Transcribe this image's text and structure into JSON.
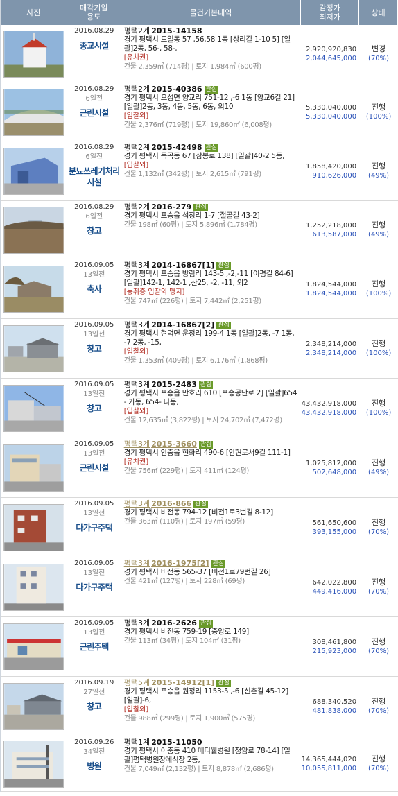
{
  "header": {
    "photo": "사진",
    "date_use": "매각기일\n용도",
    "info": "물건기본내역",
    "price": "감정가\n최저가",
    "status": "상태"
  },
  "listings": [
    {
      "date": "2016.08.29",
      "ago": "",
      "use": "종교시설",
      "court": "평택2계",
      "case": "2015-14158",
      "interest": "",
      "addr": "경기 평택시 도일동 57 ,56,58 1동 [상리길 1-10 5] [일괄]2동, 56-, 58-,",
      "tags": "[유치권]",
      "size": "건물 2,359㎡ (714평) | 토지 1,984㎡ (600평)",
      "appraisal": "2,920,920,830",
      "minprice": "2,044,645,000",
      "status": "변경",
      "rate": "(70%)",
      "visited": false,
      "photo": "church"
    },
    {
      "date": "2016.08.29",
      "ago": "6일전",
      "use": "근린시설",
      "court": "평택2계",
      "case": "2015-40386",
      "interest": "관심",
      "addr": "경기 평택시 오성면 양교리 751-12 ,-6 1동 [양교6길 21] [일괄]2동, 3동, 4동, 5동, 6동, 외10",
      "tags": "[입찰외]",
      "size": "건물 2,376㎡ (719평) | 토지 19,860㎡ (6,008평)",
      "appraisal": "5,330,040,000",
      "minprice": "5,330,040,000",
      "status": "진행",
      "rate": "(100%)",
      "visited": false,
      "photo": "greenhouse"
    },
    {
      "date": "2016.08.29",
      "ago": "6일전",
      "use": "분뇨쓰레기처리시설",
      "court": "평택2계",
      "case": "2015-42498",
      "interest": "관심",
      "addr": "경기 평택시 독곡동 67 [삼봉로 138] [일괄]40-2 5동,",
      "tags": "[입찰외]",
      "size": "건물 1,132㎡ (342평) | 토지 2,615㎡ (791평)",
      "appraisal": "1,858,420,000",
      "minprice": "910,626,000",
      "status": "진행",
      "rate": "(49%)",
      "visited": false,
      "photo": "warehouse"
    },
    {
      "date": "2016.08.29",
      "ago": "6일전",
      "use": "창고",
      "court": "평택2계",
      "case": "2016-279",
      "interest": "관심",
      "addr": "경기 평택시 포승읍 석정리 1-7 [절골길 43-2]",
      "tags": "",
      "size": "건물 198㎡ (60평) | 토지 5,896㎡ (1,784평)",
      "appraisal": "1,252,218,000",
      "minprice": "613,587,000",
      "status": "진행",
      "rate": "(49%)",
      "visited": false,
      "photo": "field"
    },
    {
      "date": "2016.09.05",
      "ago": "13일전",
      "use": "축사",
      "court": "평택3계",
      "case": "2014-16867[1]",
      "interest": "관심",
      "addr": "경기 평택시 포승읍 방림리 143-5 ,-2,-11 [이평길 84-6] [일괄]142-1, 142-1 ,산25, -2, -11, 외2",
      "tags": "[농취증  입찰외  맹지]",
      "size": "건물 747㎡ (226평) | 토지 7,442㎡ (2,251평)",
      "appraisal": "1,824,544,000",
      "minprice": "1,824,544,000",
      "status": "진행",
      "rate": "(100%)",
      "visited": false,
      "photo": "barn"
    },
    {
      "date": "2016.09.05",
      "ago": "13일전",
      "use": "창고",
      "court": "평택3계",
      "case": "2014-16867[2]",
      "interest": "관심",
      "addr": "경기 평택시 현덕면 운정리 199-4 1동 [일괄]2동, -7 1동, -7 2동, -15,",
      "tags": "[입찰외]",
      "size": "건물 1,353㎡ (409평) | 토지 6,176㎡ (1,868평)",
      "appraisal": "2,348,214,000",
      "minprice": "2,348,214,000",
      "status": "진행",
      "rate": "(100%)",
      "visited": false,
      "photo": "shed"
    },
    {
      "date": "2016.09.05",
      "ago": "13일전",
      "use": "창고",
      "court": "평택3계",
      "case": "2015-2483",
      "interest": "관심",
      "addr": "경기 평택시 포승읍 만호리 610 [포승공단로 2] [일괄]654- 가동, 654- 나동,",
      "tags": "[입찰외]",
      "size": "건물 12,635㎡ (3,822평) | 토지 24,702㎡ (7,472평)",
      "appraisal": "43,432,918,000",
      "minprice": "43,432,918,000",
      "status": "진행",
      "rate": "(100%)",
      "visited": false,
      "photo": "factory"
    },
    {
      "date": "2016.09.05",
      "ago": "13일전",
      "use": "근린시설",
      "court": "평택3계",
      "case": "2015-3660",
      "interest": "관심",
      "addr": "경기 평택시 안중읍 현화리 490-6 [안현로서9길 111-1]",
      "tags": "[유치권]",
      "size": "건물 756㎡ (229평) | 토지 411㎡ (124평)",
      "appraisal": "1,025,812,000",
      "minprice": "502,648,000",
      "status": "진행",
      "rate": "(49%)",
      "visited": true,
      "photo": "shop"
    },
    {
      "date": "2016.09.05",
      "ago": "13일전",
      "use": "다가구주택",
      "court": "평택3계",
      "case": "2016-866",
      "interest": "관심",
      "addr": "경기 평택시 비전동 794-12 [비전1로3번길 8-12]",
      "tags": "",
      "size": "건물 363㎡ (110평) | 토지 197㎡ (59평)",
      "appraisal": "561,650,600",
      "minprice": "393,155,000",
      "status": "진행",
      "rate": "(70%)",
      "visited": true,
      "photo": "brick"
    },
    {
      "date": "2016.09.05",
      "ago": "13일전",
      "use": "다가구주택",
      "court": "평택3계",
      "case": "2016-1975[2]",
      "interest": "관심",
      "addr": "경기 평택시 비전동 565-37 [비전1로79번길 26]",
      "tags": "",
      "size": "건물 421㎡ (127평) | 토지 228㎡ (69평)",
      "appraisal": "642,022,800",
      "minprice": "449,416,000",
      "status": "진행",
      "rate": "(70%)",
      "visited": true,
      "photo": "tall"
    },
    {
      "date": "2016.09.05",
      "ago": "13일전",
      "use": "근린주택",
      "court": "평택3계",
      "case": "2016-2626",
      "interest": "관심",
      "addr": "경기 평택시 비전동 759-19 [중앙로 149]",
      "tags": "",
      "size": "건물 113㎡ (34평) | 토지 104㎡ (31평)",
      "appraisal": "308,461,800",
      "minprice": "215,923,000",
      "status": "진행",
      "rate": "(70%)",
      "visited": false,
      "photo": "street"
    },
    {
      "date": "2016.09.19",
      "ago": "27일전",
      "use": "창고",
      "court": "평택5계",
      "case": "2015-14912[1]",
      "interest": "관심",
      "addr": "경기 평택시 포승읍 원정리 1153-5 ,-6 [신촌길 45-12] [일괄]-6,",
      "tags": "[입찰외]",
      "size": "건물 988㎡ (299평) | 토지 1,900㎡ (575평)",
      "appraisal": "688,340,520",
      "minprice": "481,838,000",
      "status": "진행",
      "rate": "(70%)",
      "visited": true,
      "photo": "depot"
    },
    {
      "date": "2016.09.26",
      "ago": "34일전",
      "use": "병원",
      "court": "평택1계",
      "case": "2015-11050",
      "interest": "",
      "addr": "경기 평택시 이충동 410 메디웰병원 [정암로 78-14] [일괄]평택병원장례식장 2동,",
      "tags": "",
      "size": "건물 7,049㎡ (2,132평) | 토지 8,878㎡ (2,686평)",
      "appraisal": "14,365,444,020",
      "minprice": "10,055,811,000",
      "status": "진행",
      "rate": "(70%)",
      "visited": false,
      "photo": "hospital"
    }
  ]
}
